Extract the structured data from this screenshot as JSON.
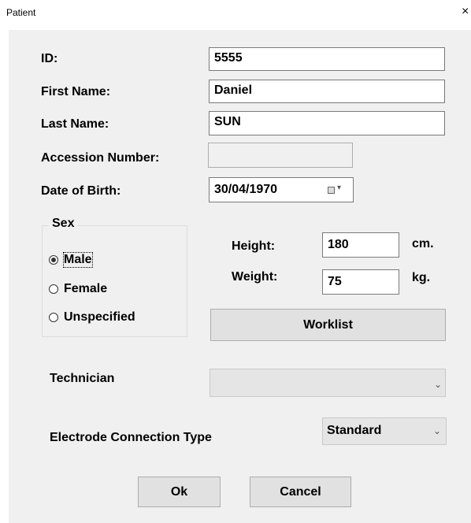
{
  "window": {
    "title": "Patient",
    "close_glyph": "×"
  },
  "fields": {
    "id_label": "ID:",
    "id_value": "5555",
    "first_name_label": "First Name:",
    "first_name_value": "Daniel",
    "last_name_label": "Last Name:",
    "last_name_value": "SUN",
    "accession_label": "Accession Number:",
    "accession_value": "",
    "dob_label": "Date of Birth:",
    "dob_value": "30/04/1970"
  },
  "sex": {
    "legend": "Sex",
    "options": [
      {
        "label": "Male",
        "selected": true
      },
      {
        "label": "Female",
        "selected": false
      },
      {
        "label": "Unspecified",
        "selected": false
      }
    ]
  },
  "body": {
    "height_label": "Height:",
    "height_value": "180",
    "height_unit": "cm.",
    "weight_label": "Weight:",
    "weight_value": "75",
    "weight_unit": "kg."
  },
  "buttons": {
    "worklist": "Worklist",
    "ok": "Ok",
    "cancel": "Cancel"
  },
  "technician": {
    "label": "Technician",
    "value": ""
  },
  "electrode": {
    "label": "Electrode Connection Type",
    "value": "Standard"
  },
  "icons": {
    "dropdown": "chevron-down-icon",
    "calendar": "calendar-icon",
    "close": "close-icon"
  }
}
